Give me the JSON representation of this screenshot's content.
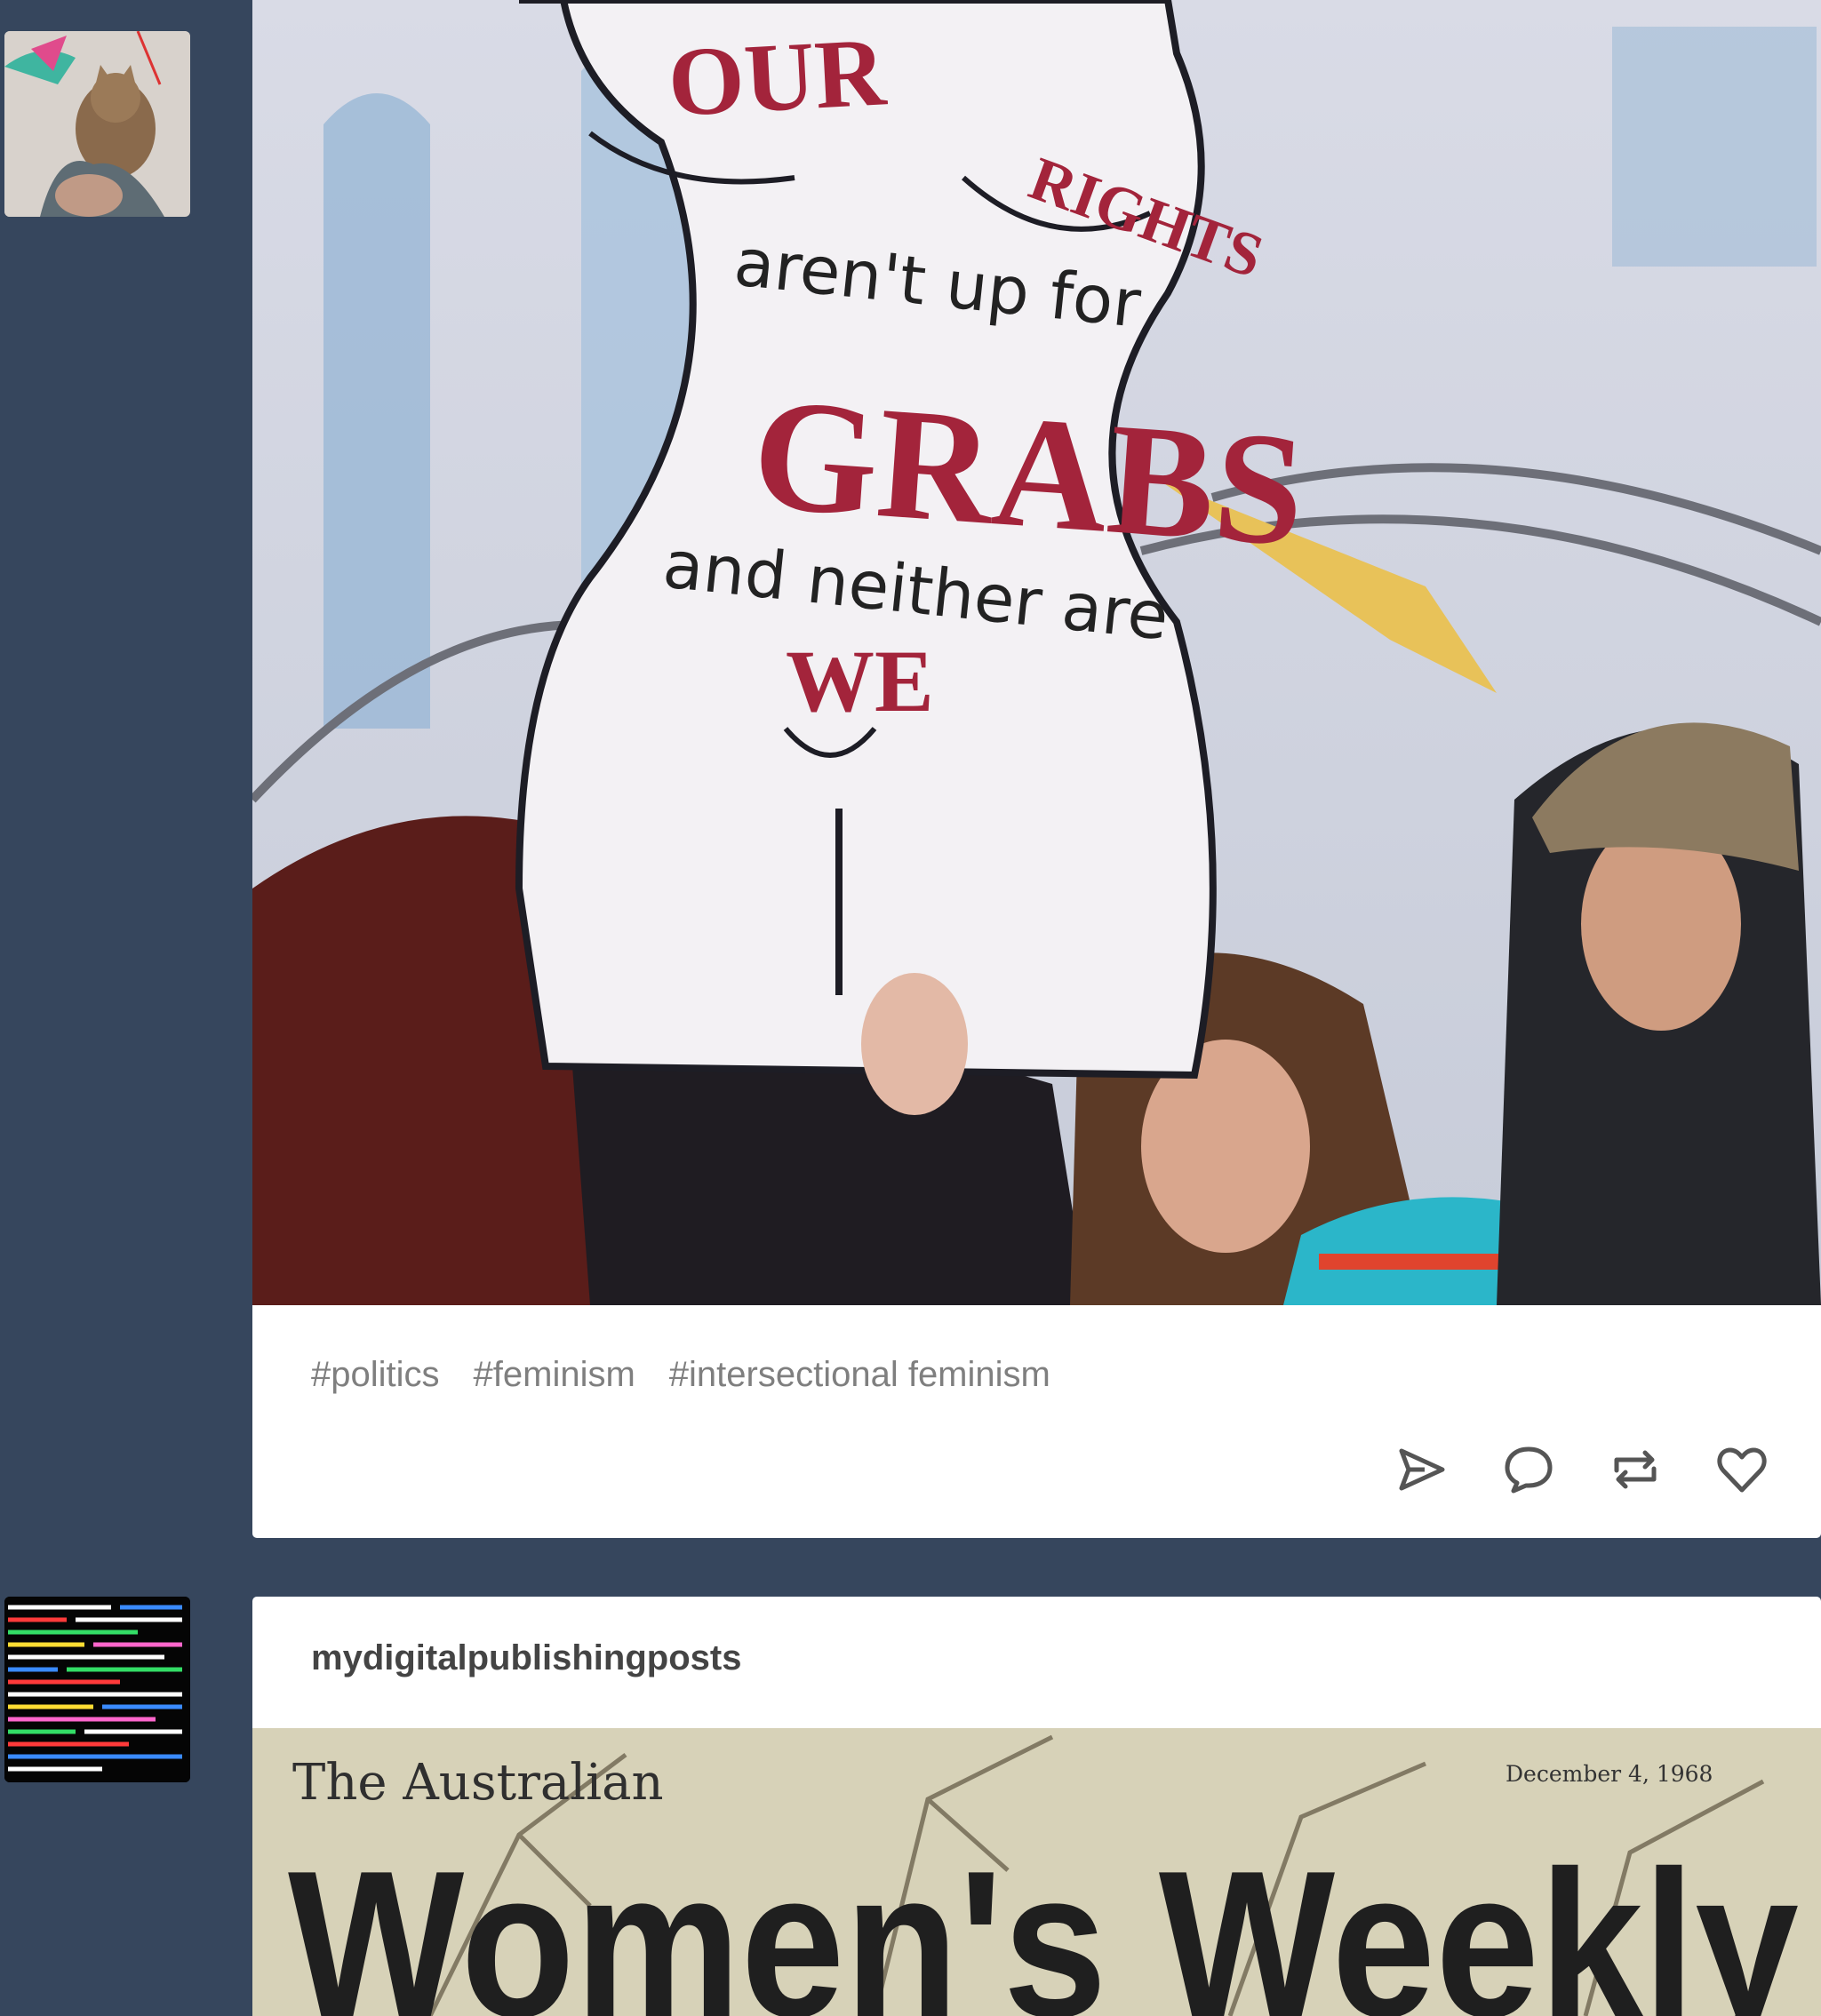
{
  "feed": {
    "posts": [
      {
        "avatar_icon": "cat-avatar",
        "image": {
          "sign_text": [
            "OUR",
            "RIGHTS",
            "aren't up for",
            "GRABS",
            "and neither are",
            "WE"
          ]
        },
        "tags": [
          "#politics",
          "#feminism",
          "#intersectional feminism"
        ],
        "actions": [
          "share-icon",
          "comment-icon",
          "reblog-icon",
          "like-icon"
        ]
      },
      {
        "avatar_icon": "code-avatar",
        "blog_name": "mydigitalpublishingposts",
        "image": {
          "masthead_small": "The Australian",
          "masthead": "Women's Weekly",
          "date": "December 4, 1968"
        }
      }
    ]
  },
  "colors": {
    "background": "#36465d",
    "card": "#ffffff",
    "tag_text": "#7f7f7f",
    "sign_red": "#a3243b"
  }
}
